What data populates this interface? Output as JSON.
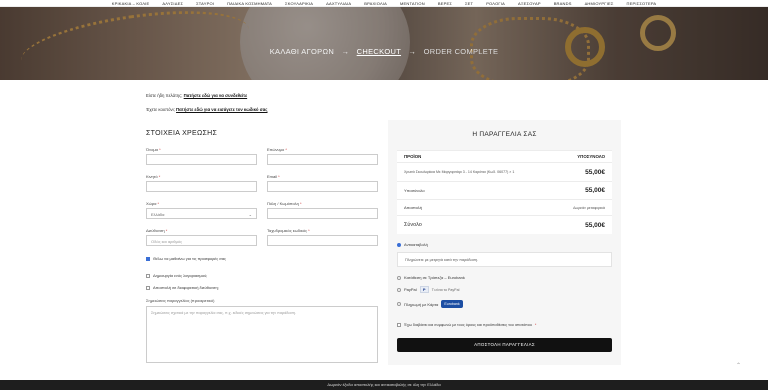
{
  "nav": [
    "ΚΡΙΚΑΚΙΑ – ΚΟΛΙΕ",
    "ΑΛΥΣΙΔΕΣ",
    "ΣΤΑΥΡΟΙ",
    "ΠΑΙΔΙΚΑ ΚΟΣΜΗΜΑΤΑ",
    "ΣΚΟΥΛΑΡΙΚΙΑ",
    "ΔΑΧΤΥΛΙΔΙΑ",
    "ΒΡΑΧΙΟΛΙΑ",
    "ΜΕΝΤΑΓΙΟΝ",
    "ΒΕΡΕΣ",
    "ΣΕΤ",
    "ΡΟΛΟΓΙΑ",
    "ΑΞΕΣΟΥΑΡ",
    "BRANDS",
    "ΔΗΜΙΟΥΡΓΙΕΣ",
    "ΠΕΡΙΣΣΟΤΕΡΑ"
  ],
  "breadcrumb": {
    "step1": "ΚΑΛΑΘΙ ΑΓΟΡΩΝ",
    "step2": "CHECKOUT",
    "step3": "ORDER COMPLETE",
    "arrow": "→"
  },
  "notices": {
    "login_text": "Είστε ήδη πελάτης;",
    "login_link": "Πατήστε εδώ για να συνδεθείτε",
    "coupon_text": "Έχετε κουπόνι;",
    "coupon_link": "Πατήστε εδώ για να εισάγετε τον κωδικό σας"
  },
  "billing": {
    "title": "ΣΤΟΙΧΕΙΑ ΧΡΕΩΣΗΣ",
    "first_name": "Όνομα",
    "last_name": "Επώνυμο",
    "company": "Κινητό",
    "email": "Email",
    "country": "Χώρα",
    "country_value": "Ελλάδα",
    "city": "Πόλη / Κωμόπολη",
    "address": "Διεύθυνση",
    "address_placeholder": "Οδός και αριθμός",
    "postcode": "Ταχυδρομικός κωδικός",
    "newsletter": "Θέλω να μαθαίνω για τις προσφορές σας",
    "create_account": "Δημιουργία ενός λογαριασμού;",
    "ship_different": "Αποστολή σε διαφορετική διεύθυνση;",
    "notes_label": "Σημειώσεις παραγγελίας (προαιρετικό)",
    "notes_placeholder": "Σημειώσεις σχετικά με την παραγγελία σας, π.χ. ειδικές σημειώσεις για την παράδοση."
  },
  "order": {
    "title": "Η ΠΑΡΑΓΓΕΛΙΑ ΣΑΣ",
    "col_product": "ΠΡΟΪΟΝ",
    "col_subtotal": "ΥΠΟΣΥΝΟΛΟ",
    "item_name": "Χρυσά Σκουλαρίκια Με Μαργαριτάρι 3 - 14 Καράτια (Κωδ. 06077) × 1",
    "item_price": "55,00€",
    "subtotal_label": "Υποσύνολο",
    "subtotal_value": "55,00€",
    "shipping_label": "Αποστολή",
    "shipping_value": "Δωρεάν μεταφορικά",
    "total_label": "Σύνολο",
    "total_value": "55,00€"
  },
  "payment": {
    "cod": "Αντικαταβολή",
    "cod_desc": "Πληρώνετε με μετρητά κατά την παράδοση.",
    "bank": "Κατάθεση σε Τράπεζα – Eurobank",
    "paypal": "PayPal",
    "paypal_badge": "P",
    "paypal_link": "Τι είναι το PayPal",
    "card": "Πληρωμή με Κάρτα",
    "card_badge": "Eurobank",
    "terms": "Έχω διαβάσει και συμφωνώ με τους όρους και προϋποθέσεις του ιστοτόπου",
    "place_order": "ΑΠΟΣΤΟΛΗ ΠΑΡΑΓΓΕΛΙΑΣ"
  },
  "cookie_bar": "Δωρεάν έξοδα αποστολής και αντικαταβολής σε όλη την Ελλάδα",
  "back_to_top": "⌃"
}
